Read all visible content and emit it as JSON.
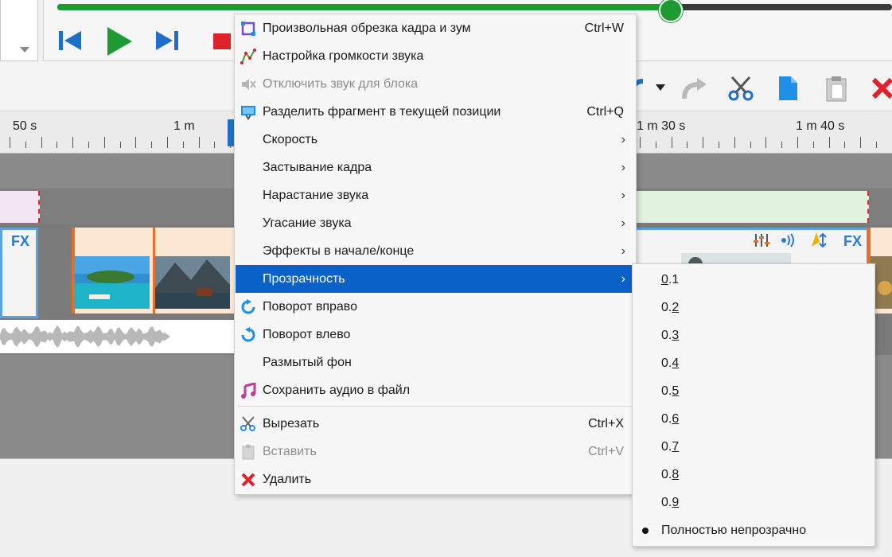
{
  "player": {
    "progress_fraction": 0.734
  },
  "ruler": {
    "labels": [
      "50 s",
      "1 m",
      "1 m 30 s",
      "1 m 40 s"
    ]
  },
  "timeline": {
    "fx_label": "FX"
  },
  "context_menu": {
    "items": [
      {
        "label": "Произвольная обрезка кадра и зум",
        "shortcut": "Ctrl+W",
        "icon": "crop-icon"
      },
      {
        "label": "Настройка громкости звука",
        "icon": "volume-curve-icon"
      },
      {
        "label": "Отключить звук для блока",
        "icon": "mute-icon",
        "disabled": true
      },
      {
        "label": "Разделить фрагмент в текущей позиции",
        "shortcut": "Ctrl+Q",
        "icon": "split-icon"
      },
      {
        "label": "Скорость",
        "submenu": true
      },
      {
        "label": "Застывание кадра",
        "submenu": true
      },
      {
        "label": "Нарастание звука",
        "submenu": true
      },
      {
        "label": "Угасание звука",
        "submenu": true
      },
      {
        "label": "Эффекты в начале/конце",
        "submenu": true
      },
      {
        "label": "Прозрачность",
        "submenu": true,
        "highlighted": true
      },
      {
        "label": "Поворот вправо",
        "icon": "rotate-right-icon"
      },
      {
        "label": "Поворот влево",
        "icon": "rotate-left-icon"
      },
      {
        "label": "Размытый фон"
      },
      {
        "label": "Сохранить аудио в файл",
        "icon": "music-note-icon"
      },
      {
        "label": "Вырезать",
        "shortcut": "Ctrl+X",
        "icon": "scissors-icon"
      },
      {
        "label": "Вставить",
        "shortcut": "Ctrl+V",
        "icon": "paste-icon",
        "disabled": true
      },
      {
        "label": "Удалить",
        "icon": "delete-icon"
      }
    ],
    "submenu_arrow": "›"
  },
  "transparency_submenu": {
    "items": [
      {
        "pre": "",
        "mn": "0",
        "post": ".1"
      },
      {
        "pre": "0.",
        "mn": "2",
        "post": ""
      },
      {
        "pre": "0.",
        "mn": "3",
        "post": ""
      },
      {
        "pre": "0.",
        "mn": "4",
        "post": ""
      },
      {
        "pre": "0.",
        "mn": "5",
        "post": ""
      },
      {
        "pre": "0.",
        "mn": "6",
        "post": ""
      },
      {
        "pre": "0.",
        "mn": "7",
        "post": ""
      },
      {
        "pre": "0.",
        "mn": "8",
        "post": ""
      },
      {
        "pre": "0.",
        "mn": "9",
        "post": ""
      }
    ],
    "selected_label": "Полностью непрозрачно"
  },
  "colors": {
    "accent_green": "#1e9a32",
    "highlight_blue": "#0a62c9",
    "delete_red": "#e0202a"
  }
}
